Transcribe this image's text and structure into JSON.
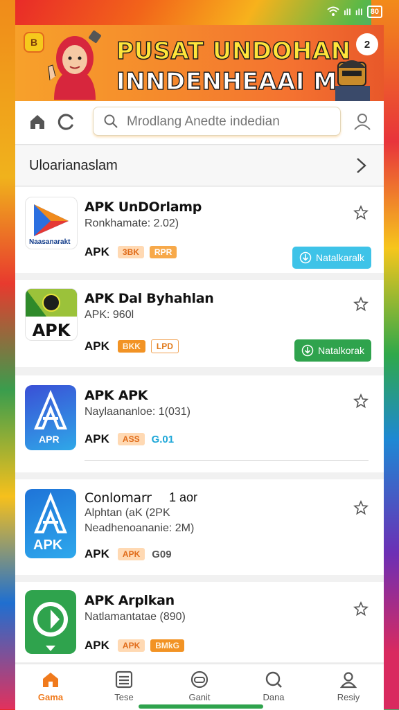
{
  "status_bar": {
    "signal": "ıll",
    "signal2": "ıll",
    "battery": "80"
  },
  "banner": {
    "badge": "B",
    "title_line1": "PUSAT UNDOHAN",
    "title_line2": "INNDENHEAAI M",
    "right_badge": "2"
  },
  "search": {
    "placeholder": "Mrodlang Anedte indedian"
  },
  "category": {
    "label": "Uloarianaslam"
  },
  "apps": [
    {
      "title": "APK UnDOrlamp",
      "subtitle": "Ronkhamate: 2.02)",
      "tag": "APK",
      "pills": [
        "3BK",
        "RPR"
      ],
      "button": "Natalkaralk",
      "button_color": "#3ec3e8",
      "icon_caption": "Naasanarakt"
    },
    {
      "title": "APK Dal Byhahlan",
      "subtitle": "APK: 960l",
      "tag": "APK",
      "pills": [
        "BKK",
        "LPD"
      ],
      "button": "Natalkorak",
      "button_color": "#2fa34d",
      "icon_caption": "APK"
    },
    {
      "title": "APK APK",
      "subtitle": "Naylaananloe: 1(031)",
      "tag": "APK",
      "pills": [
        "ASS",
        "G.01"
      ],
      "icon_caption": "APR"
    },
    {
      "title": "Conlomarr",
      "title_suffix": "1 aor",
      "subtitle": "Alphtan (aK (2PK",
      "subtitle2": "Neadhenoananie: 2M)",
      "tag": "APK",
      "pills": [
        "APK",
        "G09"
      ],
      "icon_caption": "APK"
    },
    {
      "title": "APK Arplkan",
      "subtitle": "Natlamantatae (890)",
      "tag": "APK",
      "pills": [
        "APK",
        "BMkG"
      ]
    }
  ],
  "nav": [
    {
      "label": "Gama",
      "icon": "home-icon"
    },
    {
      "label": "Tese",
      "icon": "list-icon"
    },
    {
      "label": "Ganit",
      "icon": "gamepad-icon"
    },
    {
      "label": "Dana",
      "icon": "search-icon"
    },
    {
      "label": "Resiy",
      "icon": "profile-icon"
    }
  ],
  "colors": {
    "accent": "#f07a1c",
    "blue": "#3ec3e8",
    "green": "#2fa34d"
  }
}
